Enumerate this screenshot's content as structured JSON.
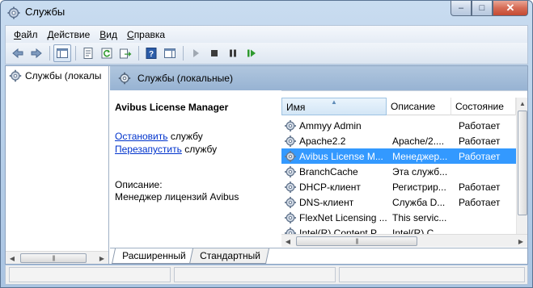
{
  "window": {
    "title": "Службы",
    "minimize": "–",
    "maximize": "□",
    "close": "✕"
  },
  "menu": [
    {
      "label_pre": "",
      "label_acc": "Ф",
      "label_post": "айл"
    },
    {
      "label_pre": "",
      "label_acc": "Д",
      "label_post": "ействие"
    },
    {
      "label_pre": "",
      "label_acc": "В",
      "label_post": "ид"
    },
    {
      "label_pre": "",
      "label_acc": "С",
      "label_post": "правка"
    }
  ],
  "toolbar": {
    "buttons": [
      "back-icon",
      "forward-icon",
      "console-tree-icon",
      "properties-icon",
      "refresh-icon",
      "export-icon",
      "help-icon",
      "show-action-pane-icon",
      "start-icon",
      "stop-icon",
      "pause-icon",
      "restart-icon"
    ]
  },
  "tree": {
    "item_label": "Службы (локалы"
  },
  "header": {
    "title": "Службы (локальные)"
  },
  "description_pane": {
    "service_name": "Avibus License Manager",
    "stop_link": "Остановить",
    "stop_suffix": " службу",
    "restart_link": "Перезапустить",
    "restart_suffix": " службу",
    "description_label": "Описание:",
    "description_text": "Менеджер лицензий Avibus"
  },
  "list": {
    "columns": [
      "Имя",
      "Описание",
      "Состояние"
    ],
    "rows": [
      {
        "name": "Ammyy Admin",
        "description": "",
        "state": "Работает",
        "selected": false
      },
      {
        "name": "Apache2.2",
        "description": "Apache/2....",
        "state": "Работает",
        "selected": false
      },
      {
        "name": "Avibus License M...",
        "description": "Менеджер...",
        "state": "Работает",
        "selected": true
      },
      {
        "name": "BranchCache",
        "description": "Эта служб...",
        "state": "",
        "selected": false
      },
      {
        "name": "DHCP-клиент",
        "description": "Регистрир...",
        "state": "Работает",
        "selected": false
      },
      {
        "name": "DNS-клиент",
        "description": "Служба D...",
        "state": "Работает",
        "selected": false
      },
      {
        "name": "FlexNet Licensing ...",
        "description": "This servic...",
        "state": "",
        "selected": false
      },
      {
        "name": "Intel(R) Content P...",
        "description": "Intel(R) C...",
        "state": "",
        "selected": false
      }
    ]
  },
  "tabs": [
    "Расширенный",
    "Стандартный"
  ],
  "colors": {
    "selection": "#3399ff",
    "link": "#0033cc",
    "header_strip": "#a3bdd9"
  }
}
